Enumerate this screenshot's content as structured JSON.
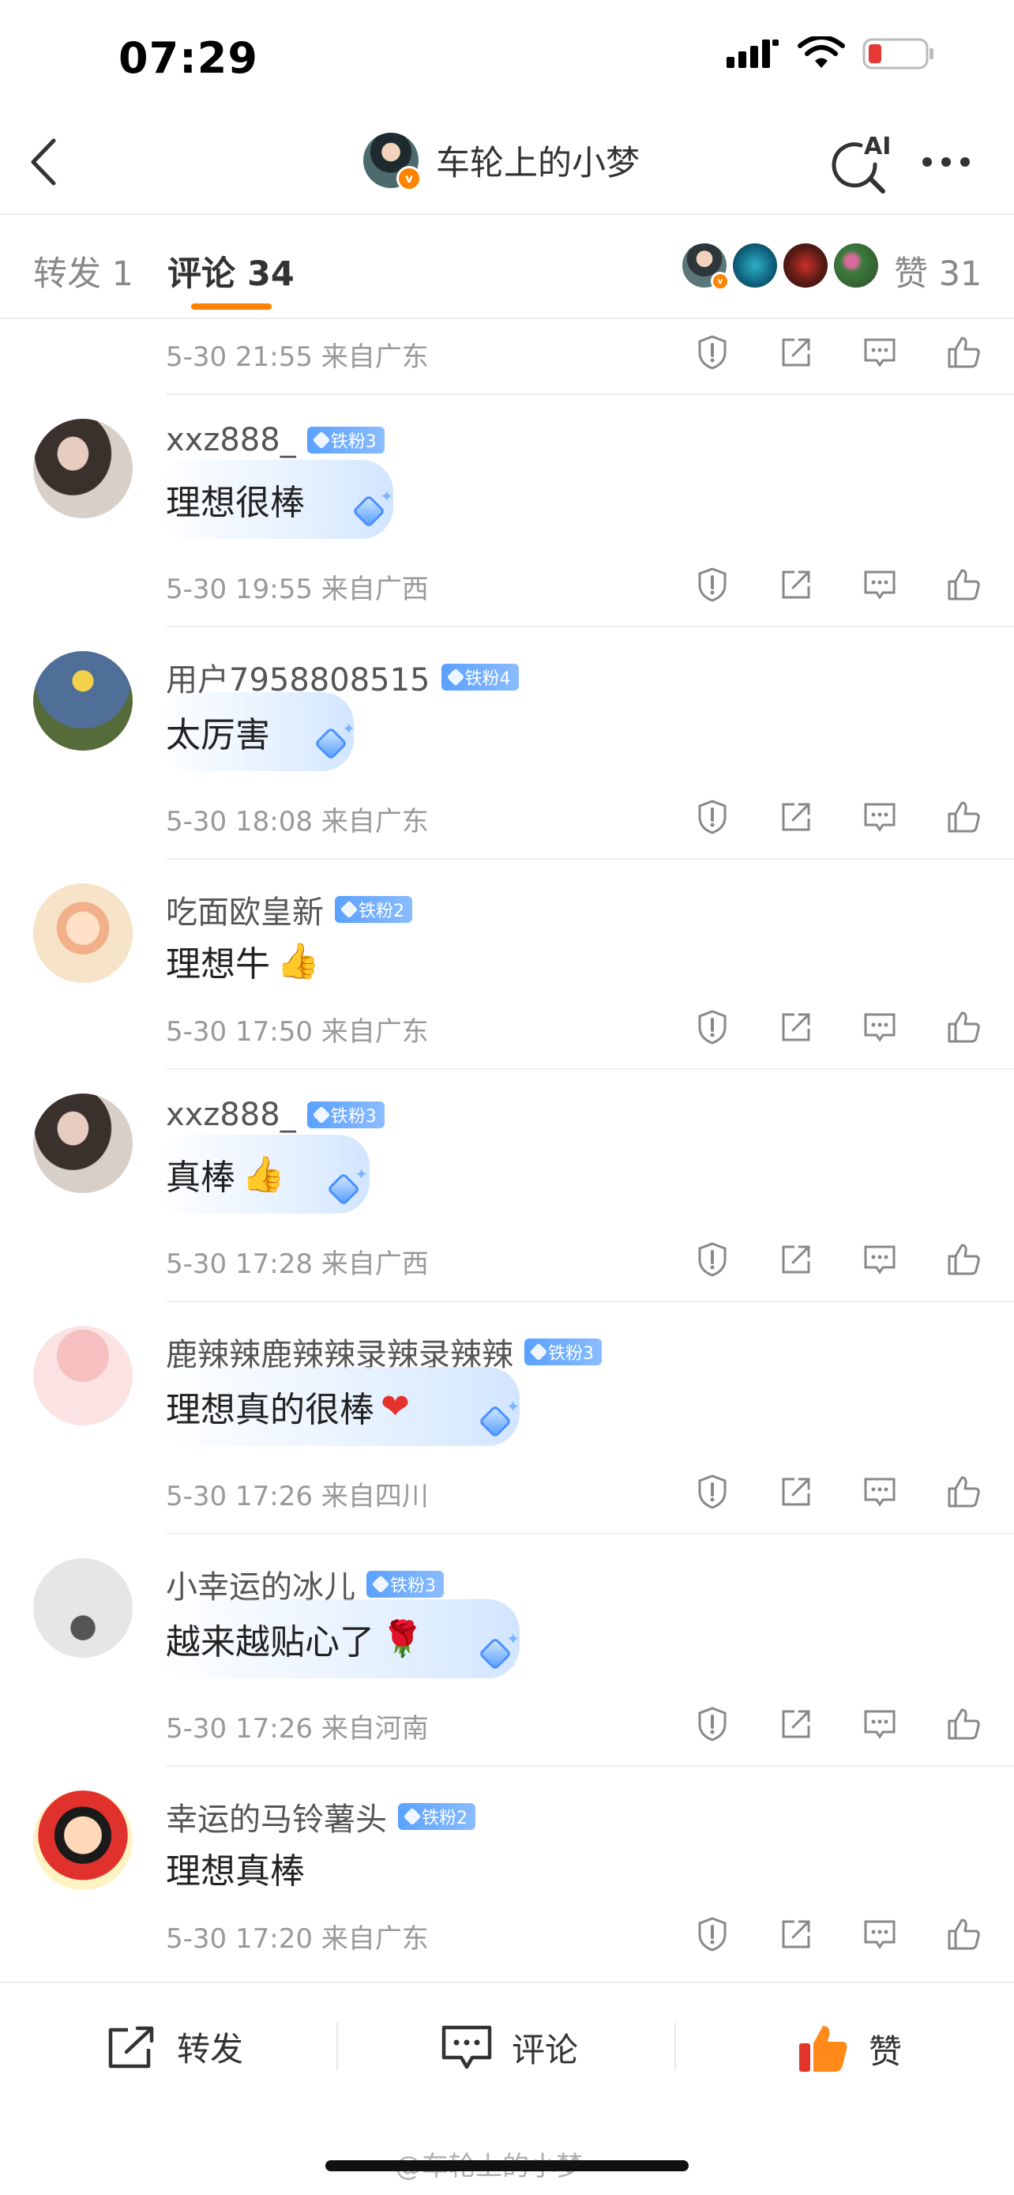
{
  "status_bar": {
    "time": "07:29"
  },
  "header": {
    "title": "车轮上的小梦",
    "ai_label": "AI"
  },
  "tabs": [
    {
      "label": "转发 1",
      "active": false
    },
    {
      "label": "评论 34",
      "active": true
    }
  ],
  "likes": {
    "label": "赞 31"
  },
  "top_meta": "5-30 21:55 来自广东",
  "comments": [
    {
      "user": "xxz888_",
      "badge": "铁粉3",
      "text": "理想很棒",
      "emoji": "",
      "meta": "5-30 19:55 来自广西"
    },
    {
      "user": "用户7958808515",
      "badge": "铁粉4",
      "text": "太厉害",
      "emoji": "",
      "meta": "5-30 18:08 来自广东"
    },
    {
      "user": "吃面欧皇新",
      "badge": "铁粉2",
      "text": "理想牛",
      "emoji": "👍",
      "meta": "5-30 17:50 来自广东"
    },
    {
      "user": "xxz888_",
      "badge": "铁粉3",
      "text": "真棒",
      "emoji": "👍",
      "meta": "5-30 17:28 来自广西"
    },
    {
      "user": "鹿辣辣鹿辣辣录辣录辣辣",
      "badge": "铁粉3",
      "text": "理想真的很棒",
      "emoji": "❤",
      "meta": "5-30 17:26 来自四川"
    },
    {
      "user": "小幸运的冰儿",
      "badge": "铁粉3",
      "text": "越来越贴心了",
      "emoji": "🌹",
      "meta": "5-30 17:26 来自河南"
    },
    {
      "user": "幸运的马铃薯头",
      "badge": "铁粉2",
      "text": "理想真棒",
      "emoji": "",
      "meta": "5-30 17:20 来自广东"
    }
  ],
  "bottom_bar": {
    "repost": "转发",
    "comment": "评论",
    "like": "赞"
  },
  "watermark": "@车轮上的小梦",
  "colors": {
    "accent": "#ff8200",
    "fan_badge": "#5aa1ff"
  }
}
